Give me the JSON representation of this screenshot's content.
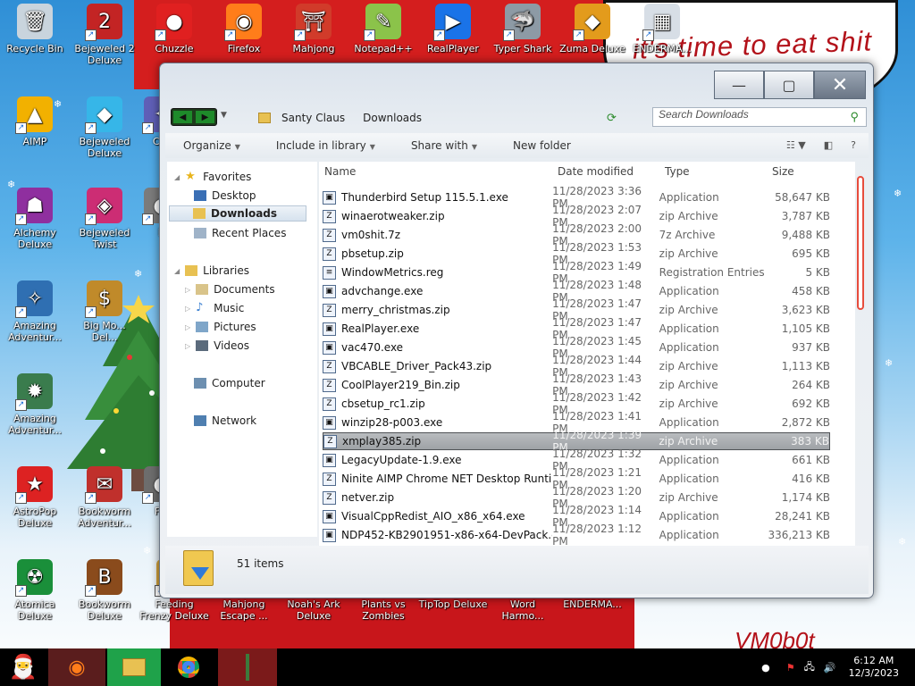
{
  "desktop": {
    "banner_text": "it's time to eat shit",
    "signature": "VM0b0t",
    "icons": [
      {
        "label": "Recycle Bin",
        "icon": "recycle-bin-icon",
        "glyph": "🗑",
        "bg": "#c9d4dd"
      },
      {
        "label": "Bejeweled 2 Deluxe",
        "icon": "bejeweled-2-icon",
        "glyph": "2",
        "bg": "#c32424"
      },
      {
        "label": "Chuzzle",
        "icon": "chuzzle-icon",
        "glyph": "●",
        "bg": "#e02020"
      },
      {
        "label": "Firefox",
        "icon": "firefox-icon",
        "glyph": "◉",
        "bg": "#ff7d1a"
      },
      {
        "label": "Mahjong",
        "icon": "mahjong-icon",
        "glyph": "⛩",
        "bg": "#d13b2a"
      },
      {
        "label": "Notepad++",
        "icon": "notepadpp-icon",
        "glyph": "✎",
        "bg": "#8bc34a"
      },
      {
        "label": "RealPlayer",
        "icon": "realplayer-icon",
        "glyph": "▶",
        "bg": "#1a73e8"
      },
      {
        "label": "Typer Shark",
        "icon": "typer-shark-icon",
        "glyph": "🦈",
        "bg": "#8d9aa5"
      },
      {
        "label": "Zuma Deluxe",
        "icon": "zuma-deluxe-icon",
        "glyph": "◆",
        "bg": "#e39b1c"
      },
      {
        "label": "ENDERMA...",
        "icon": "enderman-icon",
        "glyph": "▦",
        "bg": "#d7dee6"
      },
      {
        "label": "AIMP",
        "icon": "aimp-icon",
        "glyph": "▲",
        "bg": "#f2b100"
      },
      {
        "label": "Bejeweled Deluxe",
        "icon": "bejeweled-icon",
        "glyph": "◆",
        "bg": "#36b6e8"
      },
      {
        "label": "Cos",
        "icon": "cosmic-icon",
        "glyph": "✦",
        "bg": "#5f5fb7"
      },
      {
        "label": "Alchemy Deluxe",
        "icon": "alchemy-icon",
        "glyph": "☗",
        "bg": "#8f2f9f"
      },
      {
        "label": "Bejeweled Twist",
        "icon": "bejeweled-twist-icon",
        "glyph": "◈",
        "bg": "#cc2d74"
      },
      {
        "label": "D",
        "icon": "generic-app-icon",
        "glyph": "●",
        "bg": "#7b7b7b"
      },
      {
        "label": "Amazing Adventur...",
        "icon": "amazing-adventures-icon",
        "glyph": "✧",
        "bg": "#2f6fb2"
      },
      {
        "label": "Big Mo... Del...",
        "icon": "big-money-icon",
        "glyph": "$",
        "bg": "#c08a2a"
      },
      {
        "label": "Amazing Adventur...",
        "icon": "amazing-adventures-2-icon",
        "glyph": "✹",
        "bg": "#3a7c4d"
      },
      {
        "label": "AstroPop Deluxe",
        "icon": "astropop-icon",
        "glyph": "★",
        "bg": "#d22"
      },
      {
        "label": "Bookworm Adventur...",
        "icon": "bookworm-adventures-icon",
        "glyph": "✉",
        "bg": "#c0302c"
      },
      {
        "label": "F F",
        "icon": "generic-app-2-icon",
        "glyph": "●",
        "bg": "#6d6d6d"
      },
      {
        "label": "Atomica Deluxe",
        "icon": "atomica-icon",
        "glyph": "☢",
        "bg": "#1a8f3a"
      },
      {
        "label": "Bookworm Deluxe",
        "icon": "bookworm-icon",
        "glyph": "B",
        "bg": "#8a4b1c"
      },
      {
        "label": "Feeding Frenzy Deluxe",
        "icon": "feeding-frenzy-icon",
        "glyph": "❯",
        "bg": "#d8a63d"
      },
      {
        "label": "Mahjong Escape ...",
        "icon": "mahjong-escape-icon",
        "glyph": "▤",
        "bg": "#b54a2a"
      },
      {
        "label": "Noah's Ark Deluxe",
        "icon": "noahs-ark-icon",
        "glyph": "⛵",
        "bg": "#6e9f3a"
      },
      {
        "label": "Plants vs Zombies",
        "icon": "pvz-icon",
        "glyph": "✿",
        "bg": "#4c9e2d"
      },
      {
        "label": "TipTop Deluxe",
        "icon": "tiptop-icon",
        "glyph": "▲",
        "bg": "#3b6fc4"
      },
      {
        "label": "Word Harmo...",
        "icon": "word-harmony-icon",
        "glyph": "W",
        "bg": "#a85a2b"
      },
      {
        "label": "ENDERMA...",
        "icon": "enderman-2-icon",
        "glyph": "▦",
        "bg": "#c8d3dd"
      }
    ]
  },
  "explorer": {
    "breadcrumb": [
      "Santy Claus",
      "Downloads"
    ],
    "search_placeholder": "Search Downloads",
    "toolbar": {
      "organize": "Organize",
      "include": "Include in library",
      "share": "Share with",
      "new_folder": "New folder"
    },
    "nav": {
      "favorites": "Favorites",
      "desktop": "Desktop",
      "downloads": "Downloads",
      "recent": "Recent Places",
      "libraries": "Libraries",
      "documents": "Documents",
      "music": "Music",
      "pictures": "Pictures",
      "videos": "Videos",
      "computer": "Computer",
      "network": "Network"
    },
    "columns": {
      "name": "Name",
      "date": "Date modified",
      "type": "Type",
      "size": "Size"
    },
    "files": [
      {
        "name": "Thunderbird Setup 115.5.1.exe",
        "date": "11/28/2023 3:36 PM",
        "type": "Application",
        "size": "58,647 KB"
      },
      {
        "name": "winaerotweaker.zip",
        "date": "11/28/2023 2:07 PM",
        "type": "zip Archive",
        "size": "3,787 KB"
      },
      {
        "name": "vm0shit.7z",
        "date": "11/28/2023 2:00 PM",
        "type": "7z Archive",
        "size": "9,488 KB"
      },
      {
        "name": "pbsetup.zip",
        "date": "11/28/2023 1:53 PM",
        "type": "zip Archive",
        "size": "695 KB"
      },
      {
        "name": "WindowMetrics.reg",
        "date": "11/28/2023 1:49 PM",
        "type": "Registration Entries",
        "size": "5 KB"
      },
      {
        "name": "advchange.exe",
        "date": "11/28/2023 1:48 PM",
        "type": "Application",
        "size": "458 KB"
      },
      {
        "name": "merry_christmas.zip",
        "date": "11/28/2023 1:47 PM",
        "type": "zip Archive",
        "size": "3,623 KB"
      },
      {
        "name": "RealPlayer.exe",
        "date": "11/28/2023 1:47 PM",
        "type": "Application",
        "size": "1,105 KB"
      },
      {
        "name": "vac470.exe",
        "date": "11/28/2023 1:45 PM",
        "type": "Application",
        "size": "937 KB"
      },
      {
        "name": "VBCABLE_Driver_Pack43.zip",
        "date": "11/28/2023 1:44 PM",
        "type": "zip Archive",
        "size": "1,113 KB"
      },
      {
        "name": "CoolPlayer219_Bin.zip",
        "date": "11/28/2023 1:43 PM",
        "type": "zip Archive",
        "size": "264 KB"
      },
      {
        "name": "cbsetup_rc1.zip",
        "date": "11/28/2023 1:42 PM",
        "type": "zip Archive",
        "size": "692 KB"
      },
      {
        "name": "winzip28-p003.exe",
        "date": "11/28/2023 1:41 PM",
        "type": "Application",
        "size": "2,872 KB"
      },
      {
        "name": "xmplay385.zip",
        "date": "11/28/2023 1:39 PM",
        "type": "zip Archive",
        "size": "383 KB",
        "selected": true
      },
      {
        "name": "LegacyUpdate-1.9.exe",
        "date": "11/28/2023 1:32 PM",
        "type": "Application",
        "size": "661 KB"
      },
      {
        "name": "Ninite AIMP Chrome NET Desktop Runti...",
        "date": "11/28/2023 1:21 PM",
        "type": "Application",
        "size": "416 KB"
      },
      {
        "name": "netver.zip",
        "date": "11/28/2023 1:20 PM",
        "type": "zip Archive",
        "size": "1,174 KB"
      },
      {
        "name": "VisualCppRedist_AIO_x86_x64.exe",
        "date": "11/28/2023 1:14 PM",
        "type": "Application",
        "size": "28,241 KB"
      },
      {
        "name": "NDP452-KB2901951-x86-x64-DevPack.exe",
        "date": "11/28/2023 1:12 PM",
        "type": "Application",
        "size": "336,213 KB"
      }
    ],
    "status": "51 items"
  },
  "taskbar": {
    "time": "6:12 AM",
    "date": "12/3/2023"
  }
}
